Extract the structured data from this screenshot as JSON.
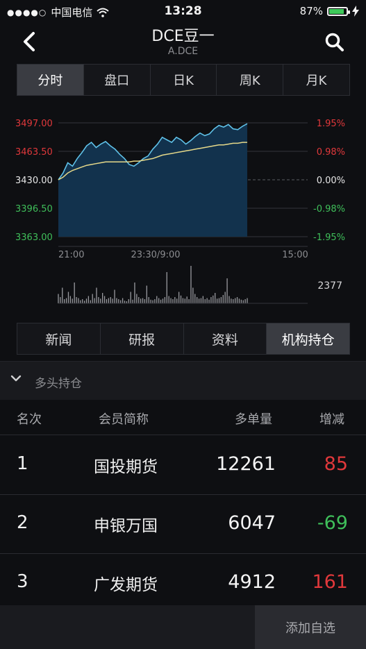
{
  "status_bar": {
    "carrier": "中国电信",
    "signal_dots": "●●●●○",
    "time": "13:28",
    "battery": "87%",
    "battery_level": 0.87
  },
  "header": {
    "title": "DCE豆一",
    "subtitle": "A.DCE"
  },
  "chart_tabs": [
    "分时",
    "盘口",
    "日K",
    "周K",
    "月K"
  ],
  "chart_data": {
    "type": "line",
    "y_ticks_left": [
      "3497.00",
      "3463.50",
      "3430.00",
      "3396.50",
      "3363.00"
    ],
    "y_ticks_right": [
      "1.95%",
      "0.98%",
      "0.00%",
      "-0.98%",
      "-1.95%"
    ],
    "ylim": [
      3363,
      3497
    ],
    "x_ticks": [
      "21:00",
      "23:30/9:00",
      "15:00"
    ],
    "series": [
      {
        "values": [
          3430,
          3438,
          3450,
          3446,
          3455,
          3462,
          3470,
          3474,
          3468,
          3472,
          3475,
          3470,
          3466,
          3460,
          3455,
          3448,
          3446,
          3450,
          3455,
          3458,
          3466,
          3472,
          3480,
          3477,
          3474,
          3480,
          3477,
          3472,
          3476,
          3481,
          3485,
          3482,
          3484,
          3490,
          3494,
          3492,
          3495,
          3490,
          3489,
          3493,
          3496
        ]
      },
      {
        "values": [
          3430,
          3433,
          3438,
          3441,
          3443,
          3445,
          3447,
          3448,
          3449,
          3450,
          3451,
          3451,
          3451,
          3451,
          3451,
          3451,
          3452,
          3452,
          3453,
          3454,
          3455,
          3457,
          3459,
          3460,
          3461,
          3462,
          3463,
          3464,
          3465,
          3466,
          3467,
          3468,
          3469,
          3470,
          3471,
          3471,
          3472,
          3473,
          3473,
          3474,
          3474
        ]
      }
    ],
    "volume_label": "2377",
    "volume": [
      18,
      12,
      30,
      8,
      10,
      22,
      14,
      9,
      40,
      12,
      10,
      6,
      8,
      5,
      9,
      14,
      6,
      18,
      10,
      30,
      12,
      9,
      20,
      14,
      8,
      10,
      12,
      9,
      26,
      10,
      8,
      6,
      10,
      5,
      4,
      8,
      22,
      7,
      40,
      18,
      12,
      9,
      10,
      8,
      34,
      12,
      7,
      6,
      8,
      14,
      10,
      7,
      9,
      12,
      60,
      14,
      10,
      8,
      12,
      9,
      22,
      15,
      10,
      9,
      13,
      8,
      72,
      30,
      18,
      12,
      9,
      10,
      14,
      8,
      10,
      7,
      12,
      15,
      20,
      9,
      10,
      12,
      16,
      22,
      48,
      14,
      9,
      8,
      10,
      12,
      9,
      7,
      6,
      8,
      10
    ]
  },
  "info_tabs": [
    "新闻",
    "研报",
    "资料",
    "机构持仓"
  ],
  "section_title": "多头持仓",
  "table": {
    "headers": [
      "名次",
      "会员简称",
      "多单量",
      "增减"
    ],
    "rows": [
      {
        "rank": "1",
        "name": "国投期货",
        "volume": "12261",
        "change": "85"
      },
      {
        "rank": "2",
        "name": "申银万国",
        "volume": "6047",
        "change": "-69"
      },
      {
        "rank": "3",
        "name": "广发期货",
        "volume": "4912",
        "change": "161"
      }
    ]
  },
  "add_button": "添加自选",
  "colors": {
    "up": "#e0383b",
    "down": "#3fbf5a",
    "price_line": "#5fc1e8",
    "avg_line": "#e6d98a",
    "area": "#12324d"
  }
}
